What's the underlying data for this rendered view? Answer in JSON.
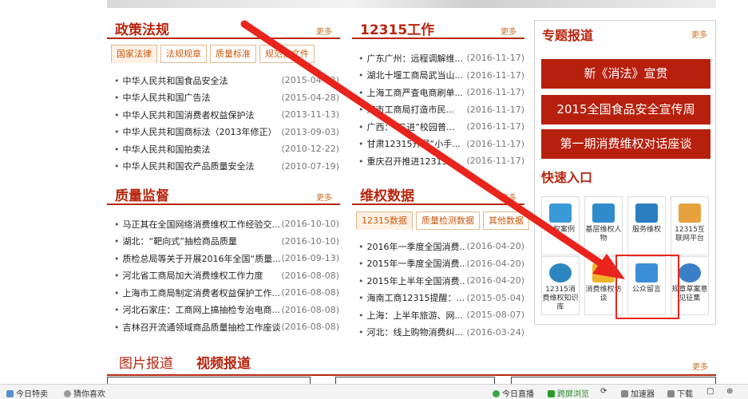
{
  "policy": {
    "title": "政策法规",
    "more": "更多",
    "tabs": [
      "国家法律",
      "法规规章",
      "质量标准",
      "规范性文件"
    ],
    "items": [
      {
        "t": "中华人民共和国食品安全法",
        "d": "(2015-04-22)"
      },
      {
        "t": "中华人民共和国广告法",
        "d": "(2015-04-28)"
      },
      {
        "t": "中华人民共和国消费者权益保护法",
        "d": "(2013-11-13)"
      },
      {
        "t": "中华人民共和国商标法（2013年修正）",
        "d": "(2013-09-03)"
      },
      {
        "t": "中华人民共和国拍卖法",
        "d": "(2010-12-22)"
      },
      {
        "t": "中华人民共和国农产品质量安全法",
        "d": "(2010-07-19)"
      }
    ]
  },
  "work12315": {
    "title": "12315工作",
    "more": "更多",
    "items": [
      {
        "t": "广东广州：远程调解维...",
        "d": "(2016-11-17)"
      },
      {
        "t": "湖北十堰工商局武当山...",
        "d": "(2016-11-17)"
      },
      {
        "t": "上海工商严查电商刷单...",
        "d": "(2016-11-17)"
      },
      {
        "t": "海市工商局打造市民...",
        "d": "(2016-11-17)"
      },
      {
        "t": "广西：“三进”校园普...",
        "d": "(2016-11-17)"
      },
      {
        "t": "甘肃12315开展“小手...",
        "d": "(2016-11-17)"
      },
      {
        "t": "重庆召开推进12315...",
        "d": "(2016-11-17)"
      }
    ]
  },
  "quality": {
    "title": "质量监督",
    "more": "更多",
    "items": [
      {
        "t": "马正其在全国网络消费维权工作经验交...",
        "d": "(2016-10-10)"
      },
      {
        "t": "湖北：“靶向式”抽检商品质量",
        "d": "(2016-10-10)"
      },
      {
        "t": "质检总局等关于开展2016年全国“质量...",
        "d": "(2016-09-13)"
      },
      {
        "t": "河北省工商局加大消费维权工作力度",
        "d": "(2016-08-08)"
      },
      {
        "t": "上海市工商局制定消费者权益保护工作...",
        "d": "(2016-08-08)"
      },
      {
        "t": "河北石家庄：工商网上搞抽检专治电商...",
        "d": "(2016-08-08)"
      },
      {
        "t": "吉林召开流通领域商品质量抽检工作座谈会",
        "d": "(2016-08-08)"
      }
    ]
  },
  "rights": {
    "title": "维权数据",
    "more": "更多",
    "tabs": [
      "12315数据",
      "质量检测数据",
      "其他数据"
    ],
    "items": [
      {
        "t": "2016年一季度全国消费...",
        "d": "(2016-04-20)"
      },
      {
        "t": "2015年一季度全国消费...",
        "d": "(2016-04-20)"
      },
      {
        "t": "2015年上半年全国消费...",
        "d": "(2016-04-20)"
      },
      {
        "t": "海南工商12315提醒：...",
        "d": "(2015-05-04)"
      },
      {
        "t": "上海：上半年旅游、网...",
        "d": "(2015-08-07)"
      },
      {
        "t": "河北：线上购物消费纠...",
        "d": "(2016-03-24)"
      }
    ]
  },
  "special": {
    "title": "专题报道",
    "more": "更多",
    "banners": [
      "新《消法》宣贯",
      "2015全国食品安全宣传周",
      "第一期消费维权对话座谈"
    ]
  },
  "quick": {
    "title": "快速入口",
    "tiles": [
      {
        "label": "维权案例",
        "icon": "envelope-icon",
        "color": "#3a9ad9"
      },
      {
        "label": "基层维权人物",
        "icon": "newspaper-icon",
        "color": "#2f8bc9"
      },
      {
        "label": "服务维权",
        "icon": "video-camera-icon",
        "color": "#2a7ec0"
      },
      {
        "label": "12315互联网平台",
        "icon": "handshake-icon",
        "color": "#e6a23c"
      },
      {
        "label": "12315消费维权知识库",
        "icon": "globe-icon",
        "color": "#2e86c1"
      },
      {
        "label": "消费维权访谈",
        "icon": "chat-bubble-icon",
        "color": "#f0b429"
      },
      {
        "label": "公众留言",
        "icon": "house-message-icon",
        "color": "#3a8fd6"
      },
      {
        "label": "规章草案意见征集",
        "icon": "people-icon",
        "color": "#3a7fc6"
      }
    ]
  },
  "bottom": {
    "tab1": "图片报道",
    "tab2": "视频报道",
    "more": "更多"
  },
  "statusbar": {
    "left1": "今日特卖",
    "left2": "猜你喜欢",
    "right": [
      "今日直播",
      "跨屏浏览",
      "加速器",
      "下载"
    ]
  },
  "colors": {
    "accent": "#b8260f",
    "annotation": "#e8241c"
  }
}
